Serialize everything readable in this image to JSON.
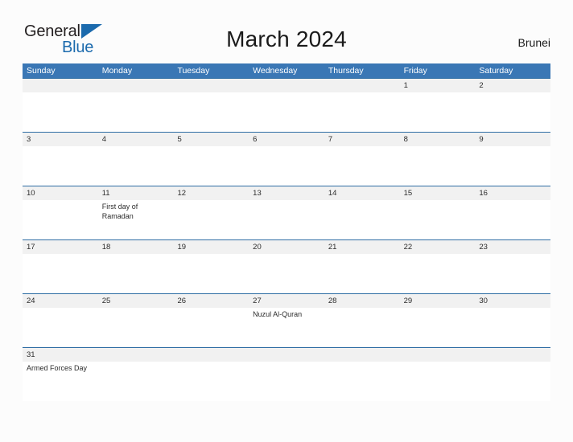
{
  "brand": {
    "logo_part1": "General",
    "logo_part2": "Blue",
    "triangle_icon": "triangle-logo-icon",
    "color_dark": "#231f20",
    "color_blue": "#1b6aad"
  },
  "header": {
    "title": "March 2024",
    "country": "Brunei"
  },
  "calendar": {
    "header_color": "#3a77b5",
    "band_color": "#f1f1f1",
    "rule_color": "#2e6da4",
    "weekdays": [
      "Sunday",
      "Monday",
      "Tuesday",
      "Wednesday",
      "Thursday",
      "Friday",
      "Saturday"
    ],
    "weeks": [
      {
        "days": [
          {
            "num": "",
            "event": ""
          },
          {
            "num": "",
            "event": ""
          },
          {
            "num": "",
            "event": ""
          },
          {
            "num": "",
            "event": ""
          },
          {
            "num": "",
            "event": ""
          },
          {
            "num": "1",
            "event": ""
          },
          {
            "num": "2",
            "event": ""
          }
        ]
      },
      {
        "days": [
          {
            "num": "3",
            "event": ""
          },
          {
            "num": "4",
            "event": ""
          },
          {
            "num": "5",
            "event": ""
          },
          {
            "num": "6",
            "event": ""
          },
          {
            "num": "7",
            "event": ""
          },
          {
            "num": "8",
            "event": ""
          },
          {
            "num": "9",
            "event": ""
          }
        ]
      },
      {
        "days": [
          {
            "num": "10",
            "event": ""
          },
          {
            "num": "11",
            "event": "First day of Ramadan"
          },
          {
            "num": "12",
            "event": ""
          },
          {
            "num": "13",
            "event": ""
          },
          {
            "num": "14",
            "event": ""
          },
          {
            "num": "15",
            "event": ""
          },
          {
            "num": "16",
            "event": ""
          }
        ]
      },
      {
        "days": [
          {
            "num": "17",
            "event": ""
          },
          {
            "num": "18",
            "event": ""
          },
          {
            "num": "19",
            "event": ""
          },
          {
            "num": "20",
            "event": ""
          },
          {
            "num": "21",
            "event": ""
          },
          {
            "num": "22",
            "event": ""
          },
          {
            "num": "23",
            "event": ""
          }
        ]
      },
      {
        "days": [
          {
            "num": "24",
            "event": ""
          },
          {
            "num": "25",
            "event": ""
          },
          {
            "num": "26",
            "event": ""
          },
          {
            "num": "27",
            "event": "Nuzul Al-Quran"
          },
          {
            "num": "28",
            "event": ""
          },
          {
            "num": "29",
            "event": ""
          },
          {
            "num": "30",
            "event": ""
          }
        ]
      },
      {
        "days": [
          {
            "num": "31",
            "event": "Armed Forces Day"
          },
          {
            "num": "",
            "event": ""
          },
          {
            "num": "",
            "event": ""
          },
          {
            "num": "",
            "event": ""
          },
          {
            "num": "",
            "event": ""
          },
          {
            "num": "",
            "event": ""
          },
          {
            "num": "",
            "event": ""
          }
        ]
      }
    ]
  }
}
